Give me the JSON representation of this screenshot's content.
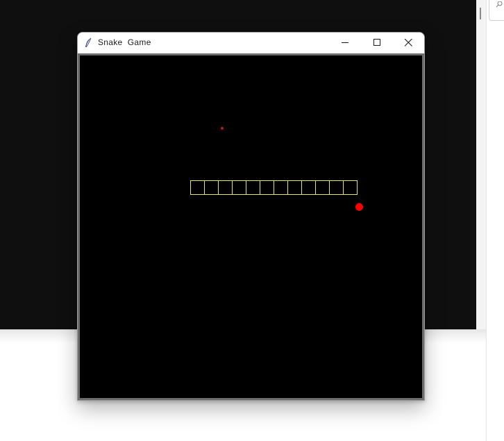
{
  "window": {
    "title": "Snake  Game",
    "icon": "feather-icon",
    "controls": [
      "minimize-icon",
      "maximize-icon",
      "close-icon"
    ]
  },
  "game": {
    "background_color": "#000000",
    "snake_color": "#e8e85a",
    "food_color": "#ff0000",
    "snake_length": 12,
    "food_items": 2
  },
  "background": {
    "search_icon": "search-icon"
  }
}
